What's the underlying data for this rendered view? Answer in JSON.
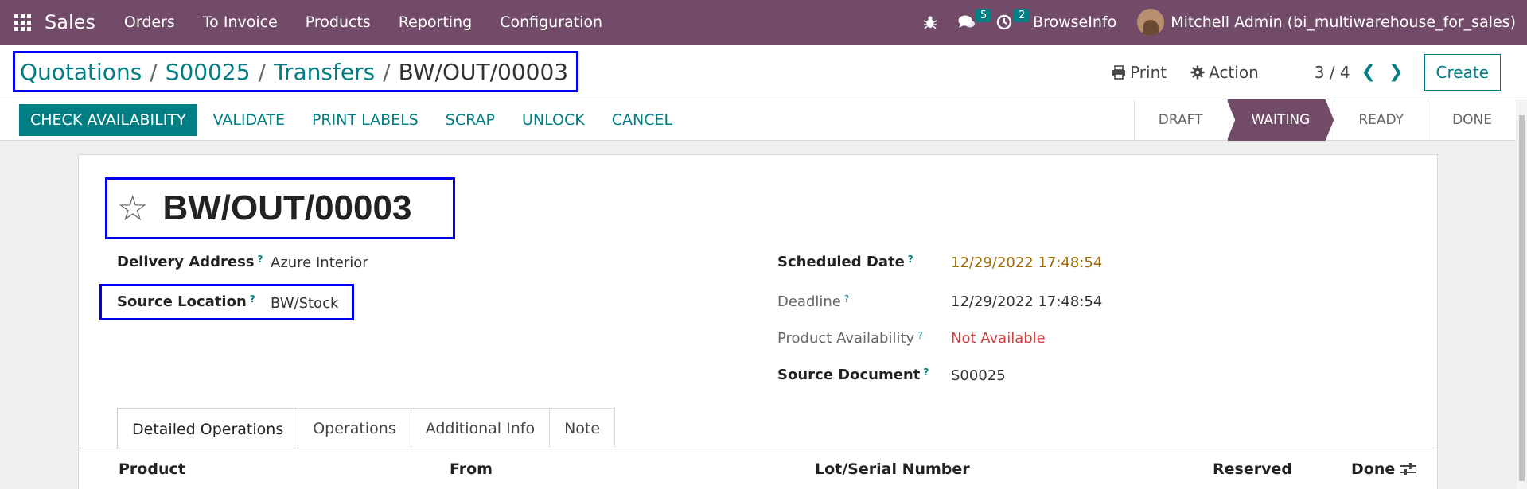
{
  "topbar": {
    "app_name": "Sales",
    "menu": [
      "Orders",
      "To Invoice",
      "Products",
      "Reporting",
      "Configuration"
    ],
    "messages_count": "5",
    "activities_count": "2",
    "company": "BrowseInfo",
    "user": "Mitchell Admin (bi_multiwarehouse_for_sales)"
  },
  "breadcrumb": {
    "items": [
      "Quotations",
      "S00025",
      "Transfers"
    ],
    "current": "BW/OUT/00003"
  },
  "toolbar": {
    "print_label": "Print",
    "action_label": "Action",
    "pager": "3 / 4",
    "create_label": "Create"
  },
  "statusbar": {
    "buttons": [
      "CHECK AVAILABILITY",
      "VALIDATE",
      "PRINT LABELS",
      "SCRAP",
      "UNLOCK",
      "CANCEL"
    ],
    "stages": [
      "DRAFT",
      "WAITING",
      "READY",
      "DONE"
    ],
    "active_stage": "WAITING"
  },
  "form": {
    "title": "BW/OUT/00003",
    "delivery_address_label": "Delivery Address",
    "delivery_address": "Azure Interior",
    "source_location_label": "Source Location",
    "source_location": "BW/Stock",
    "scheduled_date_label": "Scheduled Date",
    "scheduled_date": "12/29/2022 17:48:54",
    "deadline_label": "Deadline",
    "deadline": "12/29/2022 17:48:54",
    "availability_label": "Product Availability",
    "availability": "Not Available",
    "source_document_label": "Source Document",
    "source_document": "S00025"
  },
  "tabs": [
    "Detailed Operations",
    "Operations",
    "Additional Info",
    "Note"
  ],
  "table": {
    "headers": [
      "Product",
      "From",
      "Lot/Serial Number",
      "Reserved",
      "Done"
    ]
  },
  "colors": {
    "brand": "#714b67",
    "accent": "#017e84",
    "scheduled": "#a06a00",
    "danger": "#d23f3a",
    "highlight_box": "#0000ee"
  }
}
